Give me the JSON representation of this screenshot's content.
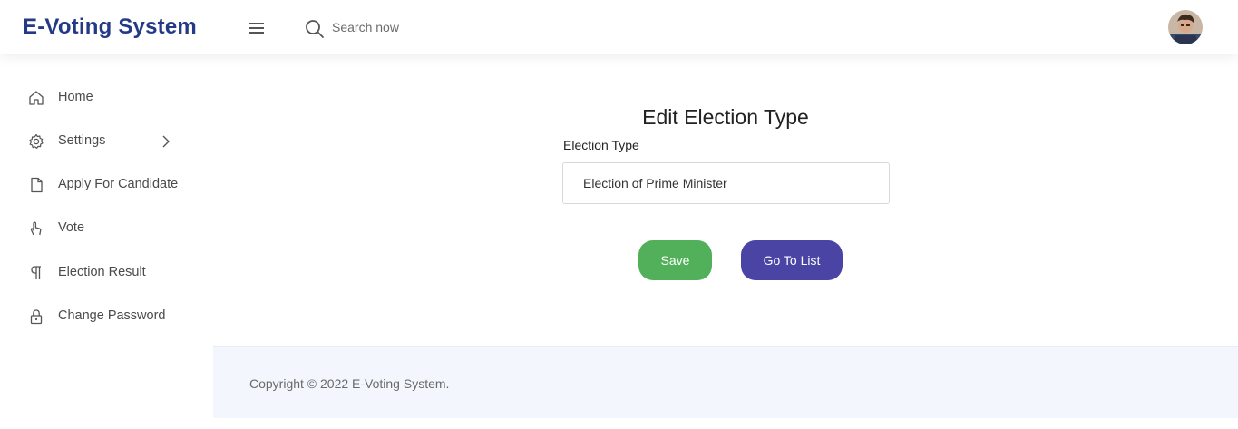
{
  "header": {
    "brand": "E-Voting System",
    "search_placeholder": "Search now"
  },
  "sidebar": {
    "items": [
      {
        "label": "Home",
        "icon": "home-icon"
      },
      {
        "label": "Settings",
        "icon": "gear-icon",
        "has_submenu": true
      },
      {
        "label": "Apply For Candidate",
        "icon": "file-icon"
      },
      {
        "label": "Vote",
        "icon": "hand-icon"
      },
      {
        "label": "Election Result",
        "icon": "paragraph-icon"
      },
      {
        "label": "Change Password",
        "icon": "lock-icon"
      }
    ]
  },
  "form": {
    "title": "Edit Election Type",
    "field_label": "Election Type",
    "field_value": "Election of Prime Minister",
    "save_label": "Save",
    "list_label": "Go To List"
  },
  "footer": {
    "text": "Copyright © 2022 E-Voting System."
  },
  "colors": {
    "brand": "#243a86",
    "save_button": "#52b05a",
    "list_button": "#4a44a4",
    "footer_bg": "#f3f6fc"
  }
}
